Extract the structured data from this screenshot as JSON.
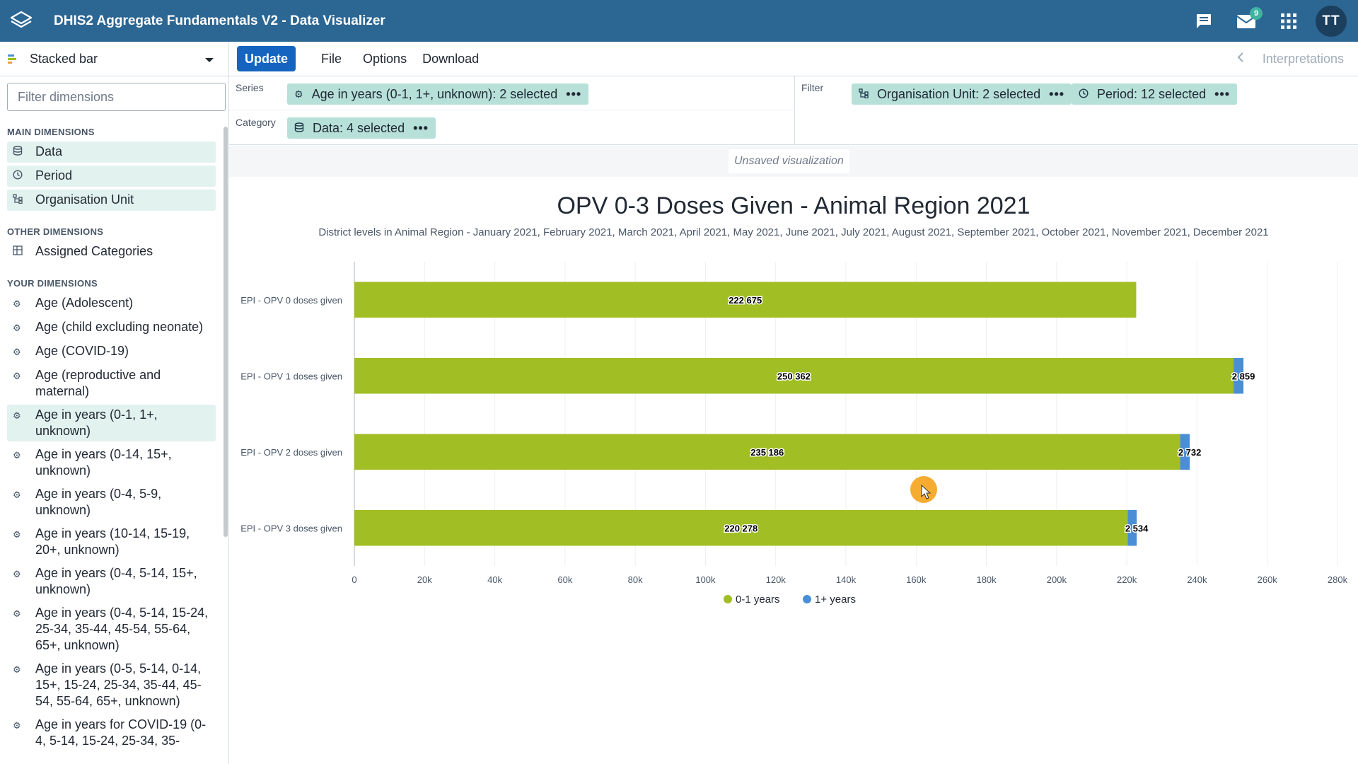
{
  "header": {
    "app_title": "DHIS2 Aggregate Fundamentals V2 - Data Visualizer",
    "mail_badge": "9",
    "avatar_initials": "TT",
    "bar_color": "#2c6693"
  },
  "left_panel": {
    "vis_type": "Stacked bar",
    "filter_placeholder": "Filter dimensions",
    "main_title": "MAIN DIMENSIONS",
    "main_items": [
      "Data",
      "Period",
      "Organisation Unit"
    ],
    "other_title": "OTHER DIMENSIONS",
    "other_items": [
      "Assigned Categories"
    ],
    "your_title": "YOUR DIMENSIONS",
    "your_items": [
      "Age (Adolescent)",
      "Age (child excluding neonate)",
      "Age (COVID-19)",
      "Age (reproductive and maternal)",
      "Age in years (0-1, 1+, unknown)",
      "Age in years (0-14, 15+, unknown)",
      "Age in years (0-4, 5-9, unknown)",
      "Age in years (10-14, 15-19, 20+, unknown)",
      "Age in years (0-4, 5-14, 15+, unknown)",
      "Age in years (0-4, 5-14, 15-24, 25-34, 35-44, 45-54, 55-64, 65+, unknown)",
      "Age in years (0-5, 5-14, 0-14, 15+, 15-24, 25-34, 35-44, 45-54, 55-64, 65+, unknown)",
      "Age in years for COVID-19 (0-4, 5-14, 15-24, 25-34, 35-"
    ],
    "selected_item": "Age in years (0-1, 1+, unknown)"
  },
  "toolbar": {
    "update": "Update",
    "file": "File",
    "options": "Options",
    "download": "Download",
    "interpretations": "Interpretations"
  },
  "layout": {
    "series_label": "Series",
    "series_chip": "Age in years (0-1, 1+, unknown): 2 selected",
    "category_label": "Category",
    "category_chip": "Data: 4 selected",
    "filter_label": "Filter",
    "filter_chip_1": "Organisation Unit: 2 selected",
    "filter_chip_2": "Period: 12 selected"
  },
  "canvas": {
    "unsaved": "Unsaved visualization"
  },
  "chart_data": {
    "type": "bar",
    "orientation": "horizontal",
    "stacked": true,
    "title": "OPV 0-3 Doses Given - Animal Region 2021",
    "subtitle": "District levels in Animal Region - January 2021, February 2021, March 2021, April 2021, May 2021, June 2021, July 2021, August 2021, September 2021, October 2021, November 2021, December 2021",
    "categories": [
      "EPI - OPV 0 doses given",
      "EPI - OPV 1 doses given",
      "EPI - OPV 2 doses given",
      "EPI - OPV 3 doses given"
    ],
    "series": [
      {
        "name": "0-1 years",
        "color": "#a1be25",
        "values": [
          222675,
          250362,
          235186,
          220278
        ],
        "labels": [
          "222 675",
          "250 362",
          "235 186",
          "220 278"
        ]
      },
      {
        "name": "1+ years",
        "color": "#4a8fd6",
        "values": [
          0,
          2859,
          2732,
          2534
        ],
        "labels": [
          "",
          "2 859",
          "2 732",
          "2 534"
        ]
      }
    ],
    "xlim": [
      0,
      280000
    ],
    "x_ticks": [
      "0",
      "20k",
      "40k",
      "60k",
      "80k",
      "100k",
      "120k",
      "140k",
      "160k",
      "180k",
      "200k",
      "220k",
      "240k",
      "260k",
      "280k"
    ],
    "grid": true,
    "legend_position": "bottom-center"
  }
}
